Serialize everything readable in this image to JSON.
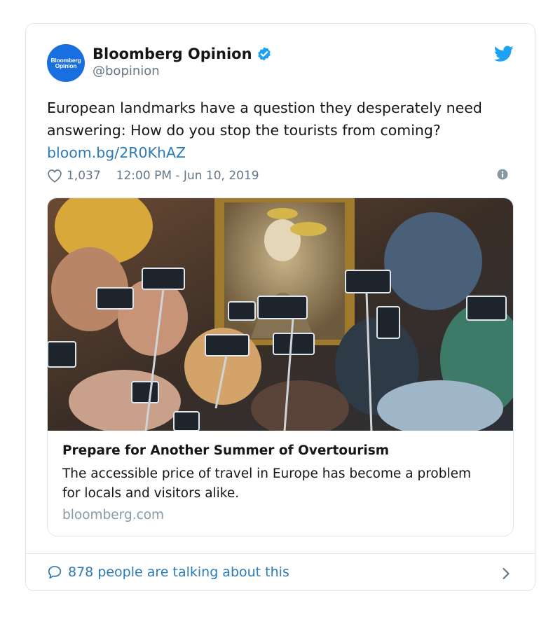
{
  "author": {
    "avatar_text_1": "Bloomberg",
    "avatar_text_2": "Opinion",
    "display_name": "Bloomberg Opinion",
    "handle": "@bopinion"
  },
  "tweet": {
    "text": "European landmarks have a question they desperately need answering: How do you stop the tourists from coming? ",
    "link": "bloom.bg/2R0KhAZ",
    "like_count": "1,037",
    "timestamp": "12:00 PM - Jun 10, 2019"
  },
  "link_card": {
    "title": "Prepare for Another Summer of Overtourism",
    "description": "The accessible price of travel in Europe has become a problem for locals and visitors alike.",
    "domain": "bloomberg.com",
    "image_icon": "crowd-photo"
  },
  "footer": {
    "talking_text": "878 people are talking about this"
  },
  "colors": {
    "brand_blue": "#1da1f2",
    "link_blue": "#2b7bb9",
    "muted": "#657786",
    "border": "#e1e8ed"
  }
}
